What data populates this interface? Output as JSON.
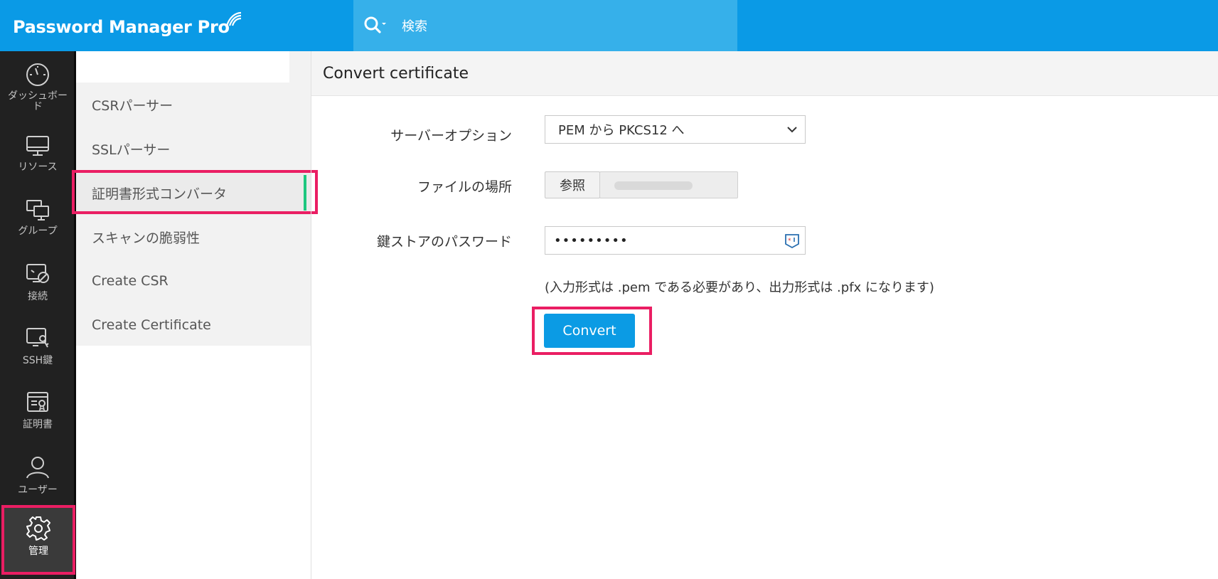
{
  "header": {
    "brand": "Password Manager Pro",
    "search_label": "検索"
  },
  "rail": {
    "items": [
      {
        "label": "ダッシュボード",
        "icon": "dashboard-gauge-icon"
      },
      {
        "label": "リソース",
        "icon": "monitor-icon"
      },
      {
        "label": "グループ",
        "icon": "group-monitors-icon"
      },
      {
        "label": "接続",
        "icon": "connect-icon"
      },
      {
        "label": "SSH鍵",
        "icon": "ssh-key-icon"
      },
      {
        "label": "証明書",
        "icon": "certificate-icon"
      },
      {
        "label": "ユーザー",
        "icon": "user-icon"
      },
      {
        "label": "管理",
        "icon": "gear-icon"
      }
    ],
    "active": "管理"
  },
  "submenu": {
    "items": [
      {
        "label": "CSRパーサー"
      },
      {
        "label": "SSLパーサー"
      },
      {
        "label": "証明書形式コンバータ"
      },
      {
        "label": "スキャンの脆弱性"
      },
      {
        "label": "Create CSR"
      },
      {
        "label": "Create Certificate"
      }
    ],
    "active": "証明書形式コンバータ"
  },
  "main": {
    "title": "Convert certificate",
    "server_option_label": "サーバーオプション",
    "server_option_value": "PEM から PKCS12 へ",
    "file_location_label": "ファイルの場所",
    "browse_label": "参照",
    "keystore_password_label": "鍵ストアのパスワード",
    "keystore_password_value": "•••••••••",
    "hint": "(入力形式は .pem である必要があり、出力形式は .pfx になります)",
    "convert_label": "Convert"
  },
  "colors": {
    "header_blue": "#0a9ae6",
    "search_blue": "#36b0ea",
    "rail_dark": "#212121",
    "highlight_pink": "#ea1e63",
    "active_green": "#1ec77f",
    "button_blue": "#0b9be4"
  }
}
